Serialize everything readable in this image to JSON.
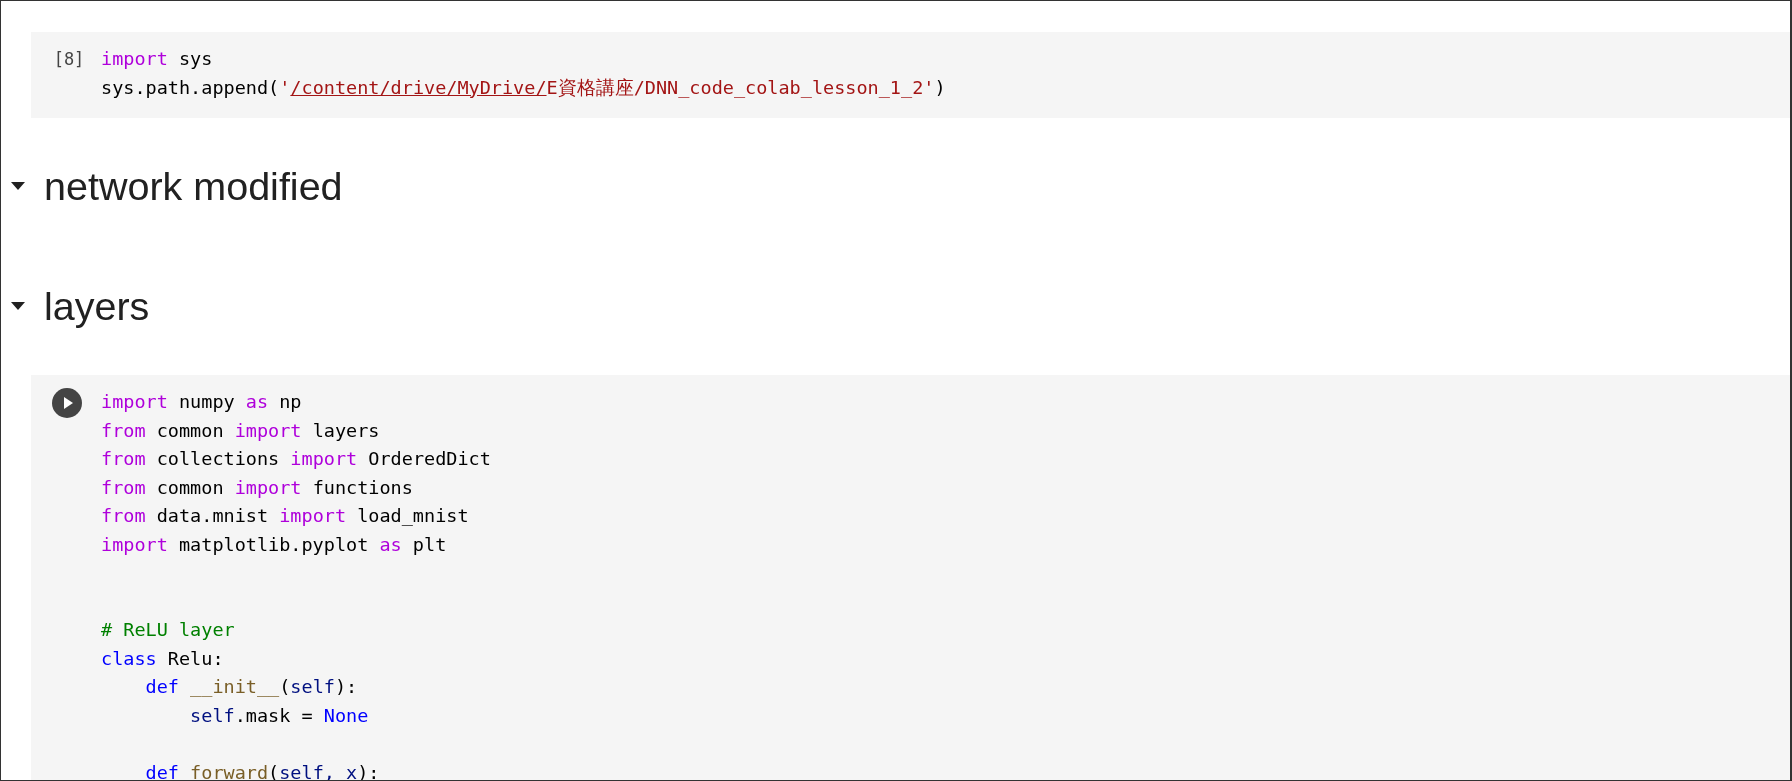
{
  "cells": [
    {
      "kind": "code",
      "execution_count": "[8]",
      "lines": [
        {
          "kind": "code",
          "tokens": [
            {
              "kind": "kw",
              "s": "import"
            },
            {
              "kind": "plain",
              "s": " sys"
            }
          ]
        },
        {
          "kind": "code",
          "tokens": [
            {
              "kind": "plain",
              "s": "sys.path.append("
            },
            {
              "kind": "string",
              "s": "'"
            },
            {
              "kind": "link",
              "s": "/content/drive/MyDrive/"
            },
            {
              "kind": "string",
              "s": "E資格講座/DNN_code_colab_lesson_1_2'"
            },
            {
              "kind": "plain",
              "s": ")"
            }
          ]
        }
      ]
    },
    {
      "kind": "heading",
      "text": "network modified",
      "expanded": true
    },
    {
      "kind": "heading",
      "text": "layers",
      "expanded": true
    },
    {
      "kind": "code",
      "lines": [
        {
          "kind": "code",
          "tokens": [
            {
              "kind": "kw",
              "s": "import"
            },
            {
              "kind": "plain",
              "s": " numpy "
            },
            {
              "kind": "kw",
              "s": "as"
            },
            {
              "kind": "plain",
              "s": " np"
            }
          ]
        },
        {
          "kind": "code",
          "tokens": [
            {
              "kind": "kw",
              "s": "from"
            },
            {
              "kind": "plain",
              "s": " common "
            },
            {
              "kind": "kw",
              "s": "import"
            },
            {
              "kind": "plain",
              "s": " layers"
            }
          ]
        },
        {
          "kind": "code",
          "tokens": [
            {
              "kind": "kw",
              "s": "from"
            },
            {
              "kind": "plain",
              "s": " collections "
            },
            {
              "kind": "kw",
              "s": "import"
            },
            {
              "kind": "plain",
              "s": " OrderedDict"
            }
          ]
        },
        {
          "kind": "code",
          "tokens": [
            {
              "kind": "kw",
              "s": "from"
            },
            {
              "kind": "plain",
              "s": " common "
            },
            {
              "kind": "kw",
              "s": "import"
            },
            {
              "kind": "plain",
              "s": " functions"
            }
          ]
        },
        {
          "kind": "code",
          "tokens": [
            {
              "kind": "kw",
              "s": "from"
            },
            {
              "kind": "plain",
              "s": " data.mnist "
            },
            {
              "kind": "kw",
              "s": "import"
            },
            {
              "kind": "plain",
              "s": " load_mnist"
            }
          ]
        },
        {
          "kind": "code",
          "tokens": [
            {
              "kind": "kw",
              "s": "import"
            },
            {
              "kind": "plain",
              "s": " matplotlib.pyplot "
            },
            {
              "kind": "kw",
              "s": "as"
            },
            {
              "kind": "plain",
              "s": " plt"
            }
          ]
        },
        {
          "kind": "blank"
        },
        {
          "kind": "blank"
        },
        {
          "kind": "code",
          "tokens": [
            {
              "kind": "comment",
              "s": "# ReLU layer"
            }
          ]
        },
        {
          "kind": "code",
          "tokens": [
            {
              "kind": "decl",
              "s": "class"
            },
            {
              "kind": "plain",
              "s": " Relu:"
            }
          ]
        },
        {
          "kind": "code",
          "tokens": [
            {
              "kind": "decl",
              "s": "    def"
            },
            {
              "kind": "fn",
              "s": " __init__"
            },
            {
              "kind": "plain",
              "s": "("
            },
            {
              "kind": "self",
              "s": "self"
            },
            {
              "kind": "plain",
              "s": "):"
            }
          ]
        },
        {
          "kind": "code",
          "tokens": [
            {
              "kind": "self",
              "s": "        self"
            },
            {
              "kind": "plain",
              "s": ".mask = "
            },
            {
              "kind": "decl",
              "s": "None"
            }
          ]
        },
        {
          "kind": "blank"
        },
        {
          "kind": "code",
          "tokens": [
            {
              "kind": "decl",
              "s": "    def"
            },
            {
              "kind": "fn",
              "s": " forward"
            },
            {
              "kind": "plain",
              "s": "("
            },
            {
              "kind": "self",
              "s": "self, x"
            },
            {
              "kind": "plain",
              "s": "):"
            }
          ]
        }
      ]
    }
  ]
}
